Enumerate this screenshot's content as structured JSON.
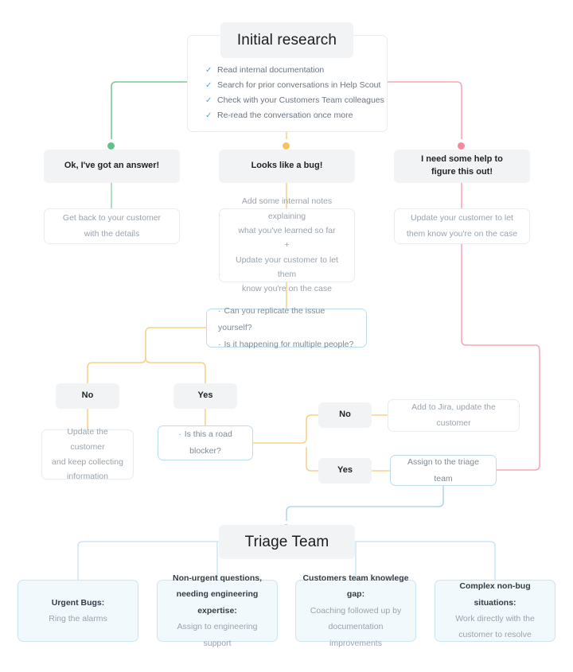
{
  "title": "Customer support triage flowchart",
  "colors": {
    "green": "#6dc193",
    "yellow": "#f7ce6b",
    "pink": "#f49aa8",
    "blue": "#9ecdea",
    "chip_bg": "#f1f3f5",
    "card_border": "#e9ecef",
    "outcome_bg": "#f2f9fd",
    "outcome_border": "#cbe5f4",
    "tick": "#4ea3e0"
  },
  "start": {
    "header": "Initial research",
    "checklist": [
      "Read internal documentation",
      "Search for prior conversations in Help Scout",
      "Check with your Customers Team colleagues",
      "Re-read the conversation once more"
    ],
    "tick_icon": "✓"
  },
  "branches": {
    "green": {
      "label": "Ok, I've got an answer!",
      "action_line1": "Get back to your customer",
      "action_line2": "with the details"
    },
    "yellow": {
      "label": "Looks like a bug!",
      "action_line1": "Add some internal notes explaining",
      "action_line2": "what you've learned so far",
      "action_plus": "+",
      "action_line3": "Update your customer to let them",
      "action_line4": "know you're on the case"
    },
    "pink": {
      "label_line1": "I need some help to",
      "label_line2": "figure this out!",
      "action_line1": "Update your customer to let",
      "action_line2": "them know you're on the case"
    }
  },
  "questions": {
    "replicate": {
      "bullet": "·",
      "line1": "Can you replicate the issue yourself?",
      "line2": "Is it happening for multiple people?"
    },
    "roadblocker": {
      "bullet": "·",
      "line1": "Is this a road blocker?"
    }
  },
  "decisions": {
    "replicate_no": "No",
    "replicate_yes": "Yes",
    "roadblocker_no": "No",
    "roadblocker_yes": "Yes"
  },
  "actions": {
    "keep_collecting_line1": "Update the customer",
    "keep_collecting_line2": "and keep collecting",
    "keep_collecting_line3": "information",
    "add_to_jira": "Add to Jira, update the customer",
    "assign_triage": "Assign to the triage team"
  },
  "triage": {
    "header": "Triage Team",
    "outcomes": [
      {
        "title": "Urgent Bugs:",
        "body_line1": "Ring the alarms",
        "body_line2": ""
      },
      {
        "title": "Non-urgent questions,",
        "title2": "needing engineering expertise:",
        "body_line1": "Assign to engineering support",
        "body_line2": ""
      },
      {
        "title": "Customers team knowlege gap:",
        "body_line1": "Coaching followed up by",
        "body_line2": "documentation improvements"
      },
      {
        "title": "Complex non-bug situations:",
        "body_line1": "Work directly with the",
        "body_line2": "customer to resolve"
      }
    ]
  }
}
